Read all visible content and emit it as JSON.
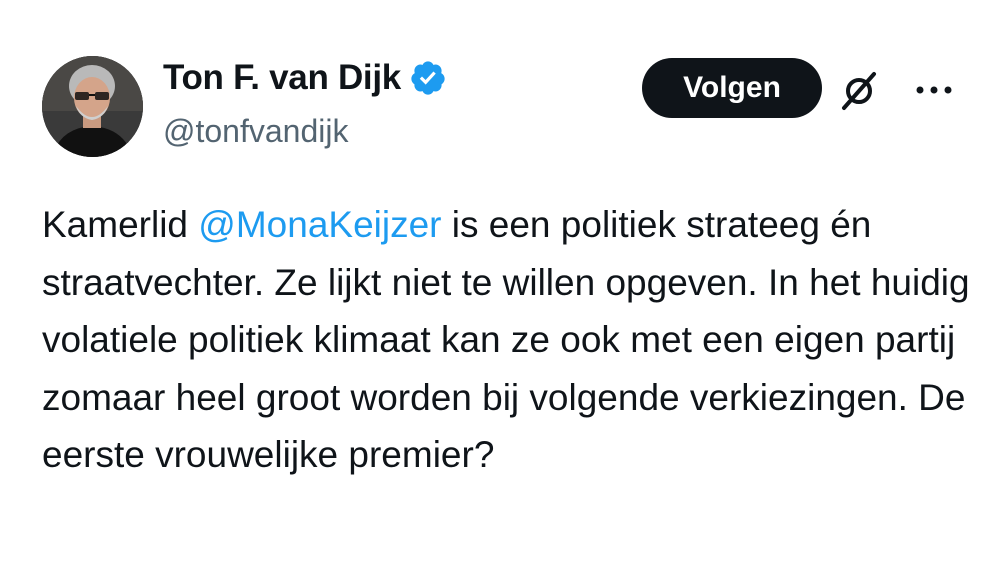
{
  "author": {
    "name": "Ton F. van Dijk",
    "handle": "@tonfvandijk",
    "verified_icon": "verified-badge-icon",
    "verified_color": "#1d9bf0"
  },
  "actions": {
    "follow_label": "Volgen",
    "grok_icon": "grok-icon",
    "more_icon": "more-options-icon"
  },
  "tweet": {
    "text_before_mention": "Kamerlid ",
    "mention": "@MonaKeijzer",
    "text_after_mention": " is een politiek strateeg én straatvechter. Ze lijkt niet te willen opgeven. In het huidig volatiele politiek klimaat kan ze ook met een eigen partij zomaar heel groot worden bij volgende verkiezingen. De eerste vrouwelijke premier?"
  },
  "colors": {
    "text": "#0f1419",
    "secondary": "#536471",
    "accent": "#1d9bf0",
    "button_bg": "#0f1419",
    "button_text": "#ffffff"
  }
}
